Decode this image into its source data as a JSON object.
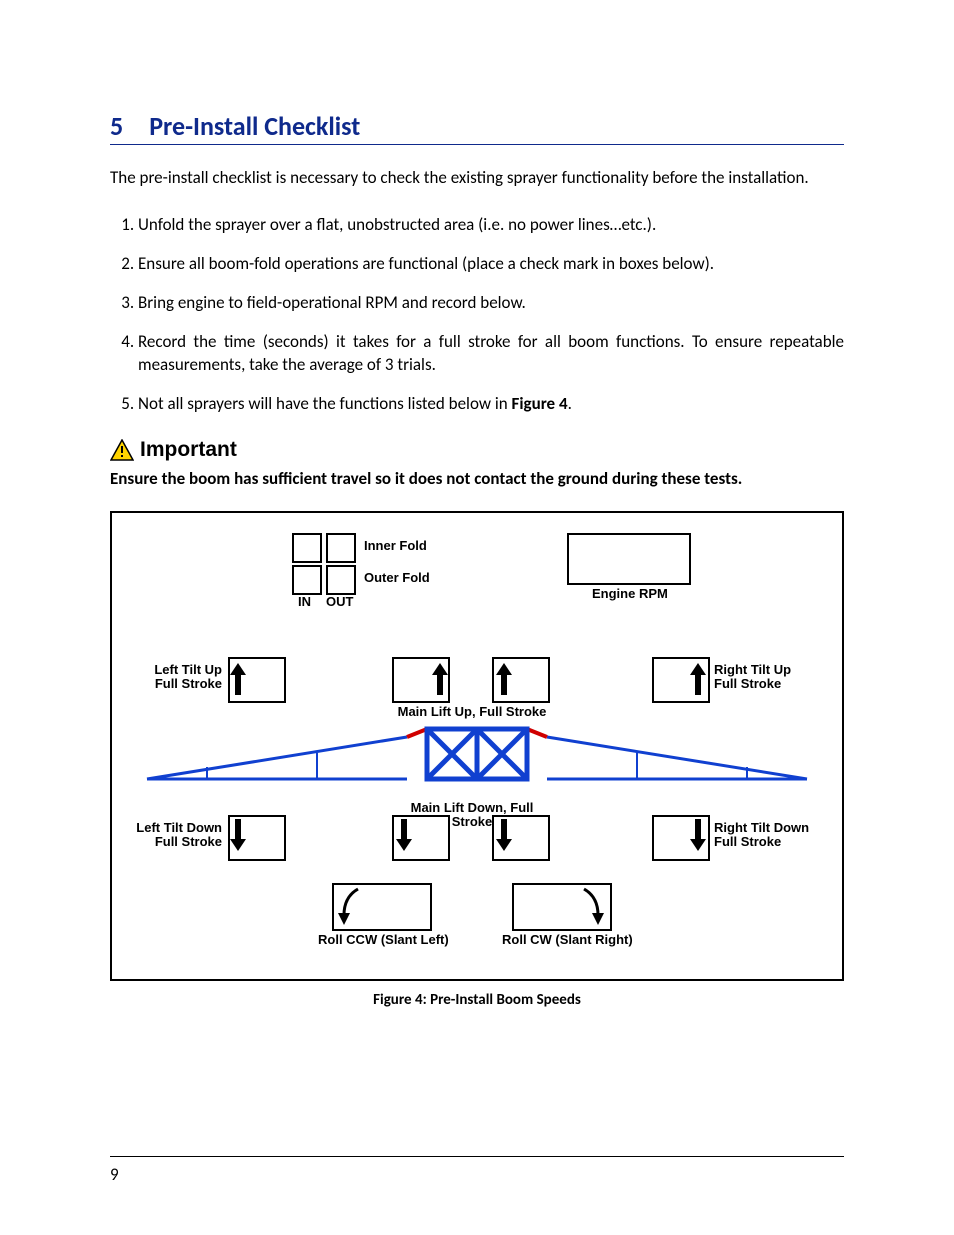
{
  "heading": {
    "number": "5",
    "title": "Pre-Install Checklist"
  },
  "intro": "The pre-install checklist is necessary to check the existing sprayer functionality before the installation.",
  "steps": [
    "Unfold the sprayer over a flat, unobstructed area (i.e. no power lines…etc.).",
    "Ensure all boom-fold operations are functional (place a check mark in boxes below).",
    "Bring engine to field-operational RPM and record below.",
    "Record the time (seconds) it takes for a full stroke for all boom functions.  To ensure repeatable measurements, take the average of 3 trials.",
    "Not all sprayers will have the functions listed below in "
  ],
  "figure_ref": "Figure 4",
  "step5_suffix": ".",
  "important": {
    "label": "Important",
    "text": "Ensure the boom has sufficient travel so it does not contact the ground during these tests."
  },
  "figure": {
    "inner_fold": "Inner Fold",
    "outer_fold": "Outer Fold",
    "in": "IN",
    "out": "OUT",
    "engine_rpm": "Engine RPM",
    "left_tilt_up": "Left Tilt Up\nFull Stroke",
    "right_tilt_up": "Right Tilt Up\nFull Stroke",
    "main_lift_up": "Main Lift Up, Full Stroke",
    "main_lift_down": "Main Lift Down, Full Stroke",
    "left_tilt_down": "Left Tilt Down\nFull Stroke",
    "right_tilt_down": "Right Tilt  Down\nFull Stroke",
    "roll_ccw": "Roll CCW (Slant Left)",
    "roll_cw": "Roll CW (Slant Right)"
  },
  "figure_caption": "Figure 4: Pre-Install Boom Speeds",
  "page_number": "9"
}
